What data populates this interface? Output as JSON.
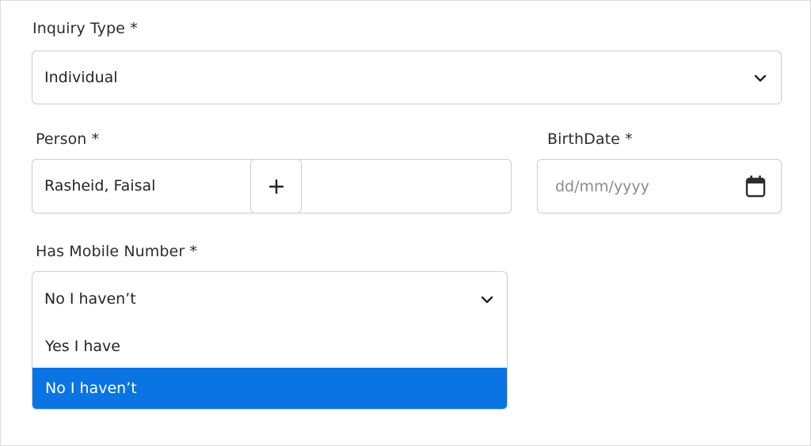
{
  "inquiry_type": {
    "label": "Inquiry Type *",
    "value": "Individual"
  },
  "person": {
    "label": "Person *",
    "value": "Rasheid, Faisal",
    "add_button_glyph": "+"
  },
  "birthdate": {
    "label": "BirthDate *",
    "placeholder": "dd/mm/yyyy"
  },
  "has_mobile": {
    "label": "Has Mobile Number *",
    "value": "No I haven’t",
    "options": [
      {
        "label": "Yes I have",
        "selected": false
      },
      {
        "label": "No I haven’t",
        "selected": true
      }
    ]
  },
  "colors": {
    "selected_option_bg": "#0a74e3",
    "border": "#c9cdd2"
  },
  "icons": {
    "dropdown": "chevron-down-icon",
    "add": "plus-icon",
    "date": "calendar-icon"
  }
}
